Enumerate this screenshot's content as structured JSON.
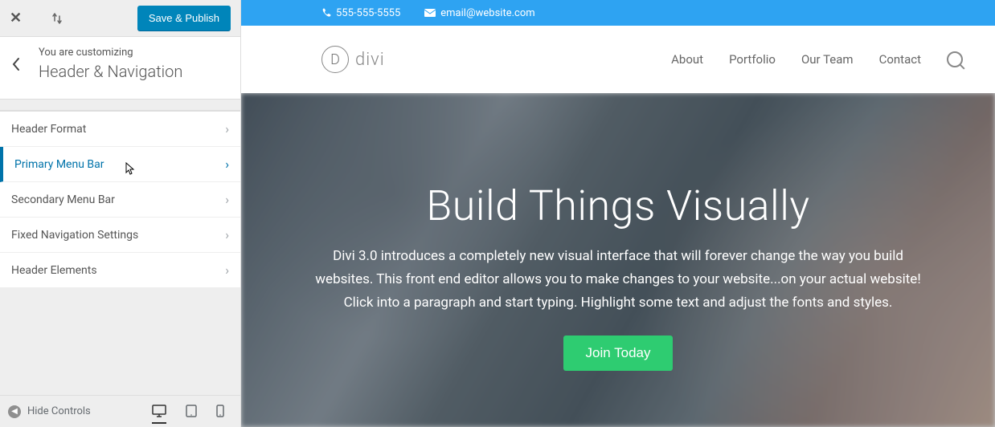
{
  "sidebar": {
    "save_publish": "Save & Publish",
    "subtitle": "You are customizing",
    "title": "Header & Navigation",
    "items": [
      {
        "label": "Header Format"
      },
      {
        "label": "Primary Menu Bar"
      },
      {
        "label": "Secondary Menu Bar"
      },
      {
        "label": "Fixed Navigation Settings"
      },
      {
        "label": "Header Elements"
      }
    ],
    "hide_controls": "Hide Controls"
  },
  "topbar": {
    "phone": "555-555-5555",
    "email": "email@website.com"
  },
  "logo": {
    "letter": "D",
    "text": "divi"
  },
  "nav": [
    "About",
    "Portfolio",
    "Our Team",
    "Contact"
  ],
  "hero": {
    "title": "Build Things Visually",
    "body": "Divi 3.0 introduces a completely new visual interface that will forever change the way you build websites. This front end editor allows you to make changes to your website...on your actual website! Click into a paragraph and start typing. Highlight some text and adjust the fonts and styles.",
    "cta": "Join Today"
  }
}
